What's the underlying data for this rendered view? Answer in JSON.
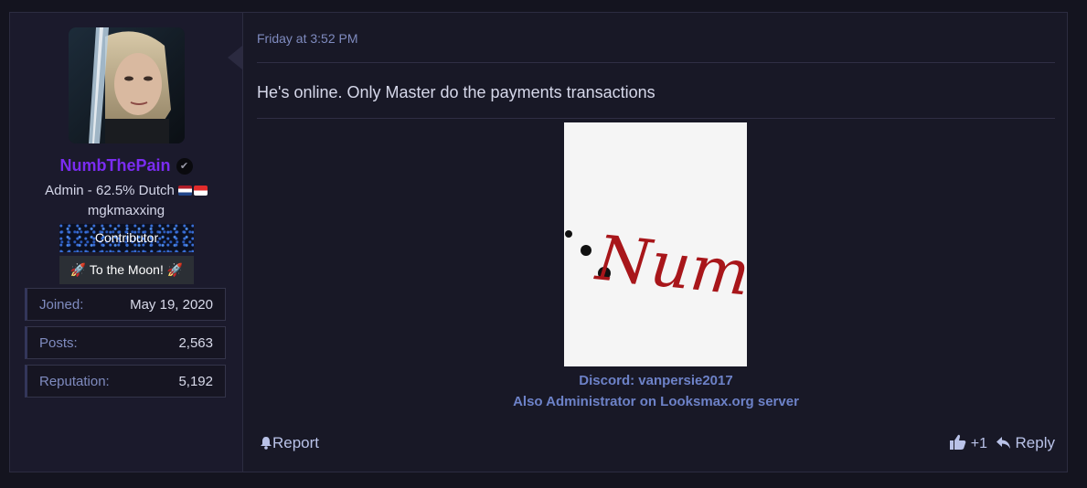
{
  "user": {
    "username": "NumbThePain",
    "title": "Admin - 62.5% Dutch",
    "custom_title": "mgkmaxxing",
    "banners": [
      "Contributor",
      "To the Moon!"
    ],
    "stats": [
      {
        "label": "Joined:",
        "value": "May 19, 2020"
      },
      {
        "label": "Posts:",
        "value": "2,563"
      },
      {
        "label": "Reputation:",
        "value": "5,192"
      }
    ]
  },
  "post": {
    "date": "Friday at 3:52 PM",
    "text": "He's online. Only Master do the payments transactions",
    "signature_image_text": "Numb",
    "signature_lines": [
      "Discord: vanpersie2017",
      "Also Administrator on Looksmax.org server"
    ]
  },
  "actions": {
    "report": "Report",
    "like_count": "+1",
    "reply": "Reply"
  },
  "colors": {
    "username": "#7a2cf0",
    "link": "#6d82c8",
    "muted": "#7f8bbf"
  },
  "icons": [
    "verified-icon",
    "flag-nl-icon",
    "flag-id-icon",
    "rocket-icon",
    "bell-icon",
    "thumbs-up-icon",
    "reply-icon"
  ]
}
